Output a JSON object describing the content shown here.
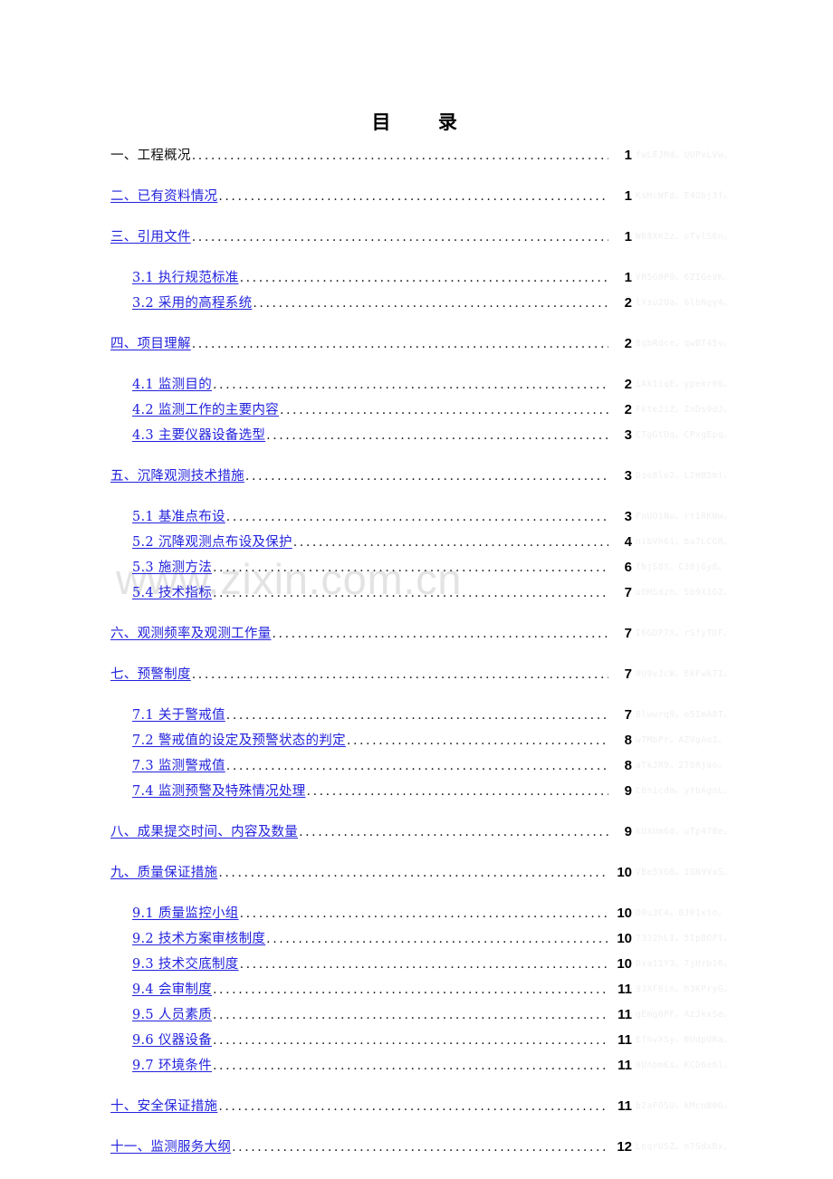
{
  "document": {
    "title": "目    录",
    "center_watermark": "www.zixin.com.cn",
    "accent_link_color": "#2222DD",
    "watermark_color": "#E3E3E3"
  },
  "toc": {
    "entries": [
      {
        "label": "一、工程概况",
        "page": "1",
        "level": 1,
        "link": false,
        "noise": "fwLEJMd。UUPvLVw。"
      },
      {
        "label": "二、已有资料情况",
        "page": "1",
        "level": 1,
        "link": true,
        "noise": "KsHcWFd。E4Obj3f。"
      },
      {
        "label": "三、引用文件",
        "page": "1",
        "level": 1,
        "link": true,
        "noise": "WB8XK2z。oTvlS6n。"
      },
      {
        "label": "3.1 执行规范标准",
        "page": "1",
        "level": 2,
        "link": true,
        "noise": "VR5G0PO。6ZIGeVK。"
      },
      {
        "label": "3.2 采用的高程系统",
        "page": "2",
        "level": 2,
        "link": true,
        "noise": "lYsu2Ua。6lbNgy4。"
      },
      {
        "label": "四、项目理解",
        "page": "2",
        "level": 1,
        "link": true,
        "noise": "BqbRdce。qwBT45v。"
      },
      {
        "label": "4.1 监测目的",
        "page": "2",
        "level": 2,
        "link": true,
        "noise": "iAk1iqE。ypekr06。"
      },
      {
        "label": "4.2 监测工作的主要内容",
        "page": "2",
        "level": 2,
        "link": true,
        "noise": "FkteJiZ。ZnDs9dJ。"
      },
      {
        "label": "4.3 主要仪器设备选型",
        "page": "3",
        "level": 2,
        "link": true,
        "noise": "CTgGtDq。CPxgEpq。"
      },
      {
        "label": "五、沉降观测技术措施",
        "page": "3",
        "level": 1,
        "link": true,
        "noise": "Dzo8lo2。L2HB5ml。"
      },
      {
        "label": "5.1 基准点布设",
        "page": "3",
        "level": 2,
        "link": true,
        "noise": "FnUO1Nu。rt1RKWw。"
      },
      {
        "label": "5.2 沉降观测点布设及保护",
        "page": "4",
        "level": 2,
        "link": true,
        "noise": "nibVh6i。ba7LCGR。"
      },
      {
        "label": "5.3 施测方法",
        "page": "6",
        "level": 2,
        "link": true,
        "noise": "fNjS8Y。C38jGyB。"
      },
      {
        "label": "5.4 技术指标",
        "page": "7",
        "level": 2,
        "link": true,
        "noise": "uOMSdzh。Sb9X1G2。"
      },
      {
        "label": "六、观测频率及观测工作量",
        "page": "7",
        "level": 1,
        "link": true,
        "noise": "I6GDP7X。rSfyTDF。"
      },
      {
        "label": "七、预警制度",
        "page": "7",
        "level": 1,
        "link": true,
        "noise": "0U9vJcW。EkFwk7I。"
      },
      {
        "label": "7.1 关于警戒值",
        "page": "7",
        "level": 2,
        "link": true,
        "noise": "Blwwrq9。o5ImA8T。"
      },
      {
        "label": "7.2 警戒值的设定及预警状态的判定",
        "page": "8",
        "level": 2,
        "link": true,
        "noise": "w7MbPr。AZVgAo1。"
      },
      {
        "label": "7.3 监测警戒值",
        "page": "8",
        "level": 2,
        "link": true,
        "noise": "aTkJR9。278Rjao。"
      },
      {
        "label": "7.4 监测预警及特殊情况处理",
        "page": "9",
        "level": 2,
        "link": true,
        "noise": "C0nicdm。yYbAgnL。"
      },
      {
        "label": "八、成果提交时间、内容及数量",
        "page": "9",
        "level": 1,
        "link": true,
        "noise": "kUXUm6d。uTp47Be。"
      },
      {
        "label": "九、质量保证措施",
        "page": "10",
        "level": 1,
        "link": true,
        "noise": "VBe5XG6。1GN9VxS。"
      },
      {
        "label": "9.1 质量监控小组",
        "page": "10",
        "level": 2,
        "link": true,
        "noise": "D0u3C4。8J01xto。"
      },
      {
        "label": "9.2 技术方案审核制度",
        "page": "10",
        "level": 2,
        "link": true,
        "noise": "7332hLI。5IpBOPt。"
      },
      {
        "label": "9.3 技术交底制度",
        "page": "10",
        "level": 2,
        "link": true,
        "noise": "Dxa11Y3。7jHrb16。"
      },
      {
        "label": "9.4 会审制度",
        "page": "11",
        "level": 2,
        "link": true,
        "noise": "9JXF6in。h3KPryG。"
      },
      {
        "label": "9.5 人员素质",
        "page": "11",
        "level": 2,
        "link": true,
        "noise": "gEmg0PF。AzJkxSe。"
      },
      {
        "label": "9.6 仪器设备",
        "page": "11",
        "level": 2,
        "link": true,
        "noise": "EfhvXSy。0UdpURa。"
      },
      {
        "label": "9.7 环境条件",
        "page": "11",
        "level": 2,
        "link": true,
        "noise": "0UnbmKs。KCD6e6l。"
      },
      {
        "label": "十、安全保证措施",
        "page": "11",
        "level": 1,
        "link": true,
        "noise": "b2aFOSU。kMcnB0G。"
      },
      {
        "label": "十一、监测服务大纲",
        "page": "12",
        "level": 1,
        "link": true,
        "noise": "LoqrUSZ。n7SdxBx。"
      }
    ]
  }
}
